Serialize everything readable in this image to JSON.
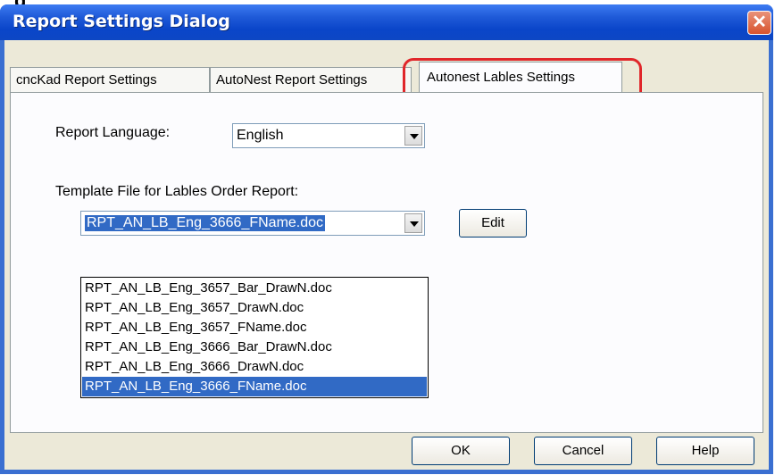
{
  "page": {
    "cropped_heading": "g"
  },
  "window": {
    "title": "Report Settings Dialog",
    "close_glyph": "✕"
  },
  "tabs": [
    {
      "label": "cncKad Report Settings"
    },
    {
      "label": "AutoNest Report Settings"
    },
    {
      "label": "Autonest Lables Settings",
      "active": true
    }
  ],
  "report_language": {
    "label": "Report Language:",
    "value": "English"
  },
  "template": {
    "label": "Template File for Lables Order Report:",
    "value": "RPT_AN_LB_Eng_3666_FName.doc",
    "options": [
      "RPT_AN_LB_Eng_3657_Bar_DrawN.doc",
      "RPT_AN_LB_Eng_3657_DrawN.doc",
      "RPT_AN_LB_Eng_3657_FName.doc",
      "RPT_AN_LB_Eng_3666_Bar_DrawN.doc",
      "RPT_AN_LB_Eng_3666_DrawN.doc",
      "RPT_AN_LB_Eng_3666_FName.doc"
    ],
    "selected_index": 5,
    "edit_label": "Edit"
  },
  "footer": {
    "ok_label": "OK",
    "cancel_label": "Cancel",
    "help_label": "Help"
  },
  "colors": {
    "titlebar": "#0a45c9",
    "highlight": "#e0262a",
    "selection": "#316ac5",
    "client": "#ece9d8"
  }
}
